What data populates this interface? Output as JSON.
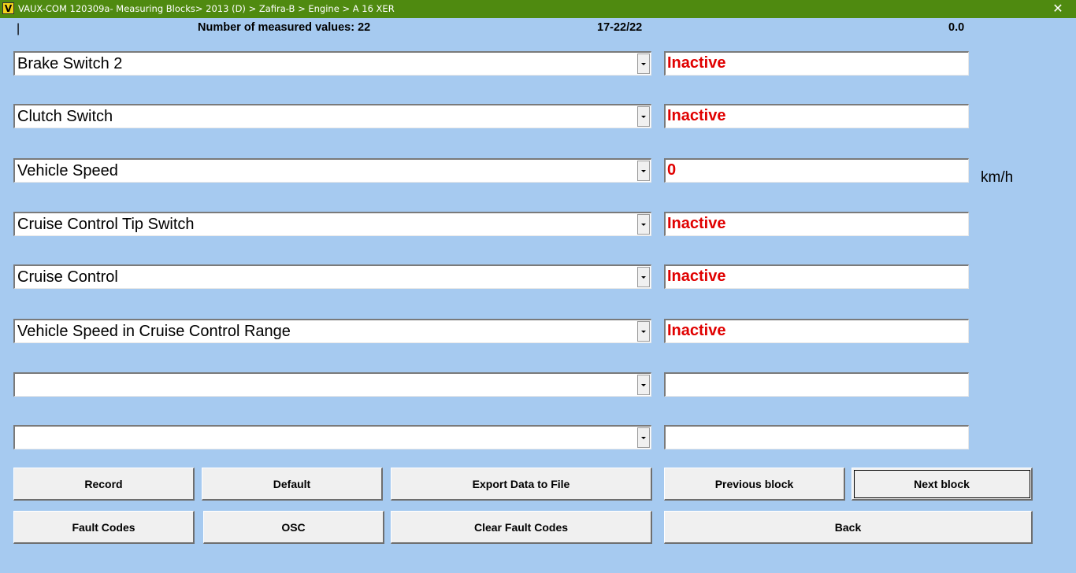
{
  "window": {
    "title": "VAUX-COM 120309a- Measuring Blocks> 2013 (D) > Zafira-B > Engine > A 16 XER",
    "logo_letter": "V",
    "close_glyph": "✕"
  },
  "header": {
    "cursor": "|",
    "count_text": "Number of measured values: 22",
    "range_text": "17-22/22",
    "time_text": "0.0"
  },
  "rows": [
    {
      "label": "Brake Switch 2",
      "value": "Inactive",
      "unit": ""
    },
    {
      "label": "Clutch Switch",
      "value": "Inactive",
      "unit": ""
    },
    {
      "label": "Vehicle Speed",
      "value": "0",
      "unit": "km/h"
    },
    {
      "label": "Cruise Control Tip Switch",
      "value": "Inactive",
      "unit": ""
    },
    {
      "label": "Cruise Control",
      "value": "Inactive",
      "unit": ""
    },
    {
      "label": "Vehicle Speed in Cruise Control Range",
      "value": "Inactive",
      "unit": ""
    },
    {
      "label": "",
      "value": "",
      "unit": ""
    },
    {
      "label": "",
      "value": "",
      "unit": ""
    }
  ],
  "buttons": {
    "record": "Record",
    "default": "Default",
    "export": "Export Data to File",
    "previous_block": "Previous block",
    "next_block": "Next block",
    "fault_codes": "Fault Codes",
    "osc": "OSC",
    "clear_fault_codes": "Clear Fault Codes",
    "back": "Back"
  },
  "colors": {
    "titlebar": "#4f8a10",
    "background": "#a6caf0",
    "value_text": "#e00000"
  }
}
